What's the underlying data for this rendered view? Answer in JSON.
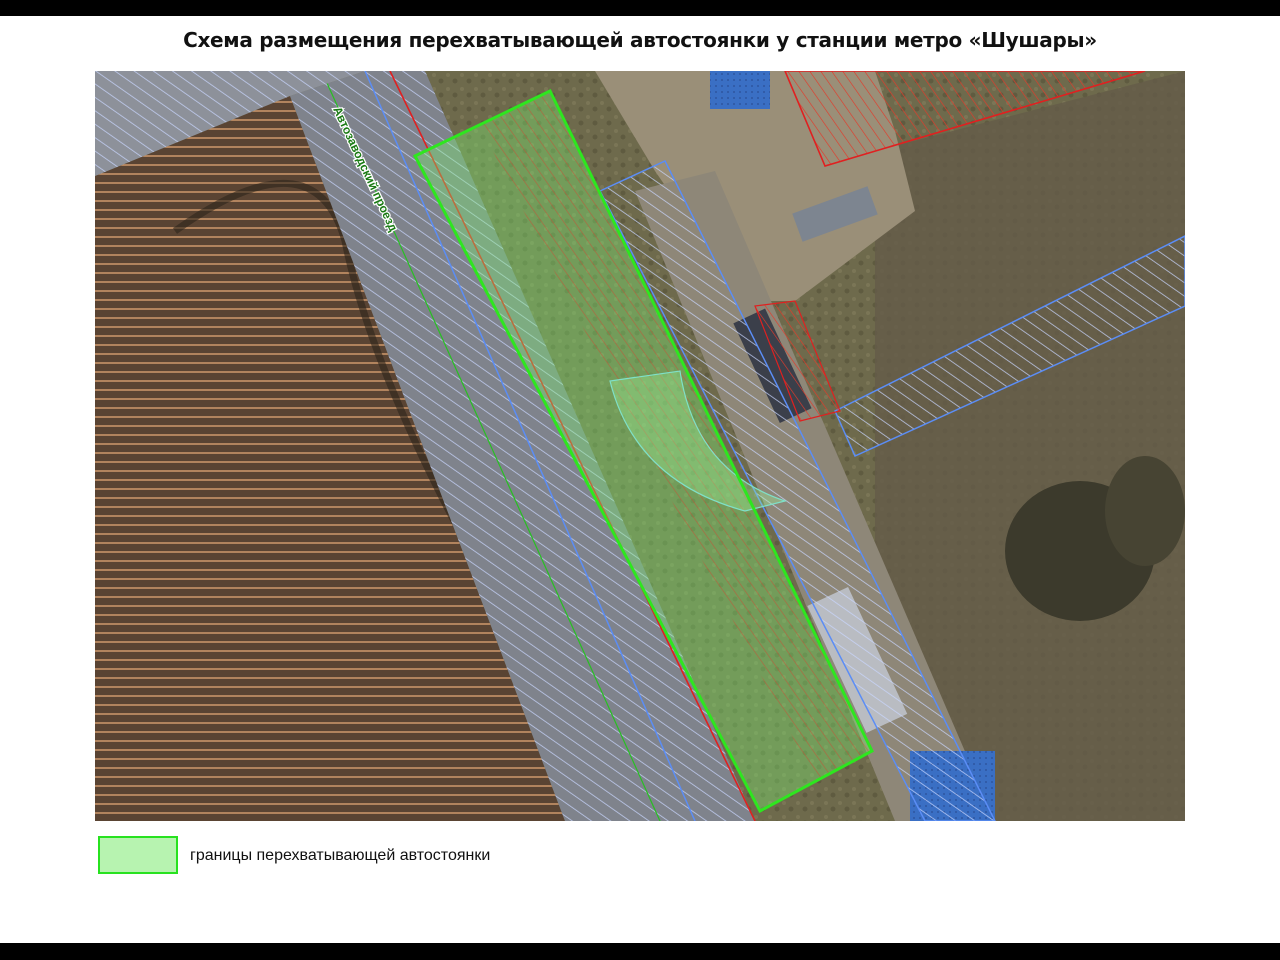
{
  "title": "Схема размещения перехватывающей автостоянки у станции метро «Шушары»",
  "map": {
    "road_label": "Автозаводский проезд",
    "colors": {
      "parking_boundary": "#2ee61f",
      "parking_fill": "#7cf070",
      "parcel_boundary": "#5b8df5",
      "red_line": "#e02020",
      "field_hatch": "#d8a070"
    }
  },
  "legend": {
    "items": [
      {
        "label": "границы перехватывающей автостоянки",
        "color": "#b7f3b0",
        "border_color": "#27e21f"
      }
    ]
  }
}
